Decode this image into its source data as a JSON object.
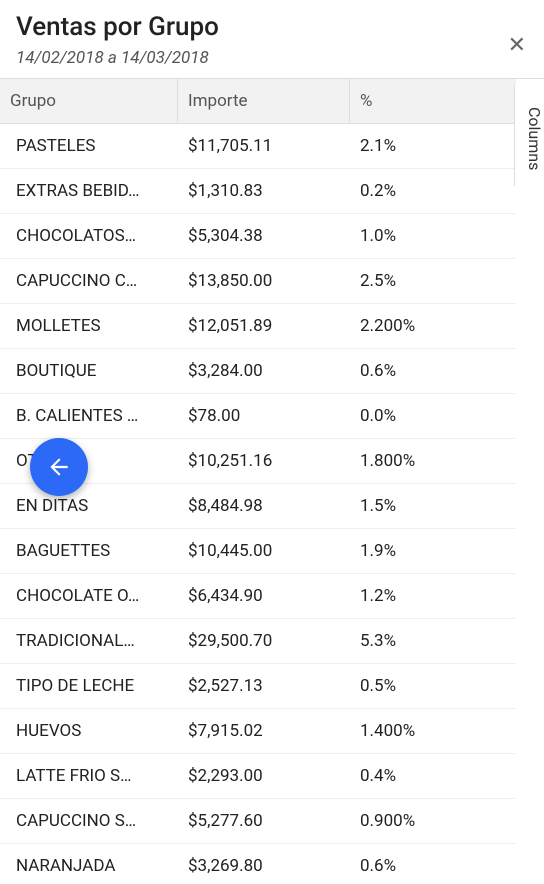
{
  "header": {
    "title": "Ventas por Grupo",
    "subtitle": "14/02/2018 a 14/03/2018"
  },
  "columns_tab": "Columns",
  "table": {
    "headers": {
      "grupo": "Grupo",
      "importe": "Importe",
      "pct": "%"
    },
    "rows": [
      {
        "grupo": "PASTELES",
        "importe": "$11,705.11",
        "pct": "2.1%"
      },
      {
        "grupo": "EXTRAS BEBID…",
        "importe": "$1,310.83",
        "pct": "0.2%"
      },
      {
        "grupo": "CHOCOLATOS…",
        "importe": "$5,304.38",
        "pct": "1.0%"
      },
      {
        "grupo": "CAPUCCINO C…",
        "importe": "$13,850.00",
        "pct": "2.5%"
      },
      {
        "grupo": "MOLLETES",
        "importe": "$12,051.89",
        "pct": "2.200%"
      },
      {
        "grupo": "BOUTIQUE",
        "importe": "$3,284.00",
        "pct": "0.6%"
      },
      {
        "grupo": "B. CALIENTES …",
        "importe": "$78.00",
        "pct": "0.0%"
      },
      {
        "grupo": "OT",
        "importe": "$10,251.16",
        "pct": "1.800%"
      },
      {
        "grupo": "EN       DITAS",
        "importe": "$8,484.98",
        "pct": "1.5%"
      },
      {
        "grupo": "BAGUETTES",
        "importe": "$10,445.00",
        "pct": "1.9%"
      },
      {
        "grupo": "CHOCOLATE O…",
        "importe": "$6,434.90",
        "pct": "1.2%"
      },
      {
        "grupo": "TRADICIONAL…",
        "importe": "$29,500.70",
        "pct": "5.3%"
      },
      {
        "grupo": "TIPO DE LECHE",
        "importe": "$2,527.13",
        "pct": "0.5%"
      },
      {
        "grupo": "HUEVOS",
        "importe": "$7,915.02",
        "pct": "1.400%"
      },
      {
        "grupo": "LATTE FRIO S…",
        "importe": "$2,293.00",
        "pct": "0.4%"
      },
      {
        "grupo": "CAPUCCINO S…",
        "importe": "$5,277.60",
        "pct": "0.900%"
      },
      {
        "grupo": "NARANJADA",
        "importe": "$3,269.80",
        "pct": "0.6%"
      }
    ]
  }
}
